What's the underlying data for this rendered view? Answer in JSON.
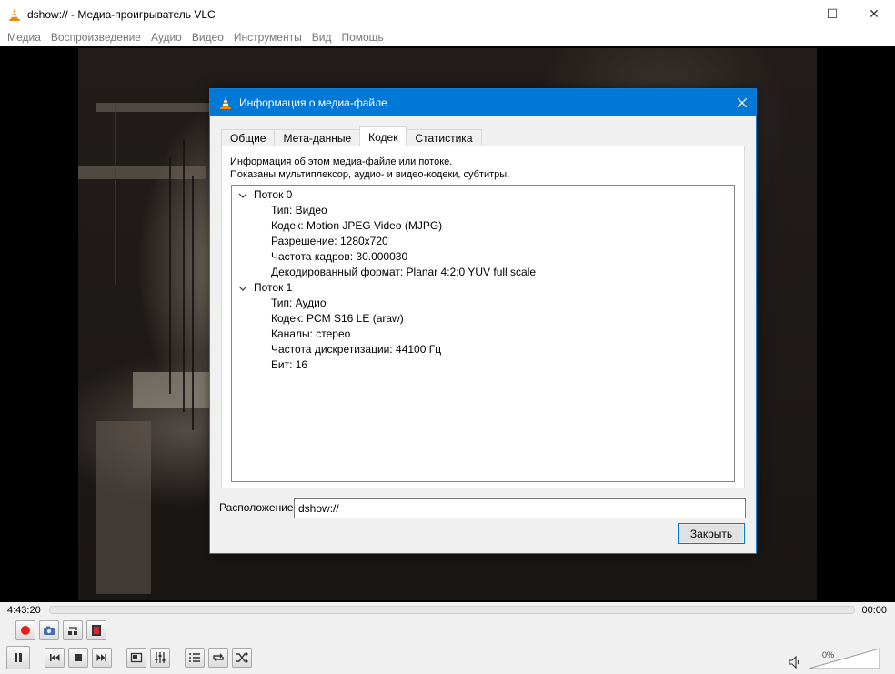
{
  "window": {
    "title": "dshow:// - Медиа-проигрыватель VLC",
    "minimize_glyph": "—",
    "maximize_glyph": "☐",
    "close_glyph": "✕"
  },
  "menu": [
    "Медиа",
    "Воспроизведение",
    "Аудио",
    "Видео",
    "Инструменты",
    "Вид",
    "Помощь"
  ],
  "dialog": {
    "title": "Информация о медиа-файле",
    "tabs": [
      "Общие",
      "Мета-данные",
      "Кодек",
      "Статистика"
    ],
    "active_tab": "Кодек",
    "description_line1": "Информация об этом медиа-файле или потоке.",
    "description_line2": "Показаны мультиплексор, аудио- и видео-кодеки, субтитры.",
    "streams": [
      {
        "label": "Поток 0",
        "props": [
          "Тип: Видео",
          "Кодек: Motion JPEG Video (MJPG)",
          "Разрешение: 1280x720",
          "Частота кадров: 30.000030",
          "Декодированный формат: Planar 4:2:0 YUV full scale"
        ]
      },
      {
        "label": "Поток 1",
        "props": [
          "Тип: Аудио",
          "Кодек: PCM S16 LE (araw)",
          "Каналы: стерео",
          "Частота дискретизации: 44100 Гц",
          "Бит: 16"
        ]
      }
    ],
    "location_label": "Расположение:",
    "location_value": "dshow://",
    "close_button": "Закрыть"
  },
  "player": {
    "time_elapsed": "4:43:20",
    "time_total": "00:00",
    "volume_percent": "0%"
  },
  "icons": {
    "app": "vlc-cone-icon",
    "accent": "#0078d7",
    "record": "#e0201b"
  }
}
